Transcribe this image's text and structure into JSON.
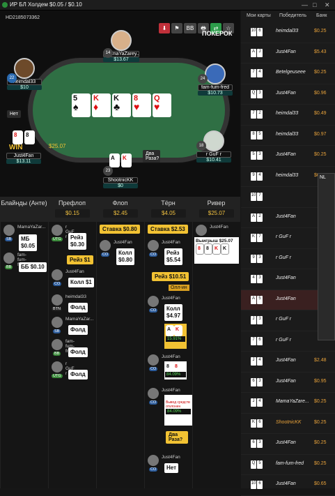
{
  "window": {
    "title": "ИР БЛ Холдем $0.05 / $0.10",
    "controls": [
      "—",
      "□",
      "✕"
    ]
  },
  "table": {
    "hand_id": "HD2185073362",
    "brand": "ПОКЕРОК",
    "toolbar": [
      "⬇",
      "⚑",
      "BB",
      "🖶",
      "⇄",
      "☆"
    ],
    "board": [
      {
        "r": "5",
        "s": "♠",
        "red": false
      },
      {
        "r": "K",
        "s": "♦",
        "red": true
      },
      {
        "r": "K",
        "s": "♣",
        "red": false
      },
      {
        "r": "8",
        "s": "♥",
        "red": true
      },
      {
        "r": "Q",
        "s": "♥",
        "red": true
      }
    ],
    "seats": [
      {
        "name": "MamaYaZarey..",
        "stack": "$13.67",
        "level": "14"
      },
      {
        "name": "heimdal33",
        "stack": "$10",
        "level": "22"
      },
      {
        "name": "fam-fum-fred",
        "stack": "$10.73",
        "level": "24"
      },
      {
        "name": "Just4Fan",
        "stack": "$13.11",
        "level": "16"
      },
      {
        "name": "r GuF r",
        "stack": "$10.41",
        "level": "18"
      },
      {
        "name": "ShootnicKK",
        "stack": "$0",
        "level": "23"
      }
    ],
    "bubble_no": "Нет",
    "bubble_twice": "Два Раза?",
    "pot": "$25.07",
    "win": "WIN"
  },
  "streets": {
    "headers": [
      "Блайнды (Анте)",
      "Префлоп",
      "Флоп",
      "Тёрн",
      "Ривер"
    ],
    "pots": [
      "$0.15",
      "$2.45",
      "$4.05",
      "$25.07"
    ]
  },
  "history": {
    "blinds": [
      {
        "name": "MamaYaZar...",
        "pos": "SB",
        "action": "МБ\n$0.05"
      },
      {
        "name": "fam-fum-fred",
        "pos": "BB",
        "action": "ББ $0.10"
      }
    ],
    "preflop": [
      {
        "name": "r GuF r",
        "pos": "UTG",
        "action": "Рейз\n$0.30"
      },
      {
        "yellow": "Рейз $1"
      },
      {
        "name": "Just4Fan",
        "pos": "CO",
        "action": "Колл $1"
      },
      {
        "name": "heimdal33",
        "pos": "BTN",
        "action": "Фолд"
      },
      {
        "name": "MamaYaZar...",
        "pos": "SB",
        "action": "Фолд"
      },
      {
        "name": "fam-fum-fred",
        "pos": "BB",
        "action": "Фолд"
      },
      {
        "name": "r GuF r",
        "pos": "UTG",
        "action": "Фолд"
      }
    ],
    "flop": [
      {
        "yellow": "Ставка $0.80"
      },
      {
        "name": "Just4Fan",
        "pos": "CO",
        "action": "Колл\n$0.80"
      }
    ],
    "turn": [
      {
        "yellow": "Ставка $2.53"
      },
      {
        "name": "Just4Fan",
        "pos": "CO",
        "action": "Рейз\n$5.54"
      },
      {
        "yellow": "Рейз $10.51"
      },
      {
        "yellow": "Олл-ин"
      },
      {
        "name": "Just4Fan",
        "pos": "CO",
        "action": "Колл\n$4.97"
      },
      {
        "cards": [
          "A",
          "K"
        ],
        "eq": "15.91%"
      },
      {
        "name": "Just4Fan",
        "pos": "CO",
        "cards": [
          "8",
          "8"
        ],
        "eq": "84.09%"
      },
      {
        "name": "Just4Fan",
        "pos": "CO",
        "note": "Вывод средств отклонен",
        "eq": "84.09%"
      },
      {
        "yellow": "Два Раза?"
      },
      {
        "name": "Just4Fan",
        "pos": "CO",
        "action": "Нет"
      }
    ],
    "river": [
      {
        "name": "Just4Fan",
        "action": "Выигрыш $25.07",
        "cards": [
          "8",
          "8",
          "K",
          "K"
        ]
      }
    ]
  },
  "right_panel": {
    "headers": [
      "Мои карты",
      "Победитель",
      "Банк"
    ],
    "rows": [
      {
        "c": [
          "10",
          "6"
        ],
        "w": "heimdal33",
        "b": "$0.25"
      },
      {
        "c": [
          "A",
          "J"
        ],
        "w": "Just4Fan",
        "b": "$5.43"
      },
      {
        "c": [
          "7",
          "4"
        ],
        "w": "Betelgeuseee",
        "b": "$0.25"
      },
      {
        "c": [
          "Q",
          "3"
        ],
        "w": "Just4Fan",
        "b": "$0.96"
      },
      {
        "c": [
          "7",
          "2"
        ],
        "w": "heimdal33",
        "b": "$0.49"
      },
      {
        "c": [
          "8",
          "5"
        ],
        "w": "heimdal33",
        "b": "$0.97"
      },
      {
        "c": [
          "5",
          "3"
        ],
        "w": "Just4Fan",
        "b": "$0.25"
      },
      {
        "c": [
          "9",
          "4"
        ],
        "w": "heimdal33",
        "b": "$0.25"
      },
      {
        "c": [
          "10",
          "7"
        ],
        "w": "",
        "b": ""
      },
      {
        "c": [
          "A",
          "2"
        ],
        "w": "Just4Fan",
        "b": ""
      },
      {
        "c": [
          "K",
          "7"
        ],
        "w": "r GuF r",
        "b": ""
      },
      {
        "c": [
          "9",
          "3"
        ],
        "w": "r GuF r",
        "b": ""
      },
      {
        "c": [
          "4",
          "3"
        ],
        "w": "Just4Fan",
        "b": ""
      },
      {
        "c": [
          "A",
          "5"
        ],
        "w": "Just4Fan",
        "b": ""
      },
      {
        "c": [
          "J",
          "3"
        ],
        "w": "r GuF r",
        "b": ""
      },
      {
        "c": [
          "7",
          "6"
        ],
        "w": "r GuF r",
        "b": ""
      },
      {
        "c": [
          "J",
          "4"
        ],
        "w": "Just4Fan",
        "b": "$2.48"
      },
      {
        "c": [
          "6",
          "3"
        ],
        "w": "Just4Fan",
        "b": "$0.95"
      },
      {
        "c": [
          "J",
          "4"
        ],
        "w": "MamaYaZare...",
        "b": "$0.25"
      },
      {
        "c": [
          "K",
          "6"
        ],
        "w": "ShootnicKK",
        "b": "$0.25"
      },
      {
        "c": [
          "6",
          "3"
        ],
        "w": "Just4Fan",
        "b": "$0.25"
      },
      {
        "c": [
          "Q",
          "5"
        ],
        "w": "fam-fum-fred",
        "b": "$0.25"
      },
      {
        "c": [
          "10",
          "6"
        ],
        "w": "Just4Fan",
        "b": "$0.65"
      }
    ]
  },
  "popup": {
    "title": "NL"
  }
}
